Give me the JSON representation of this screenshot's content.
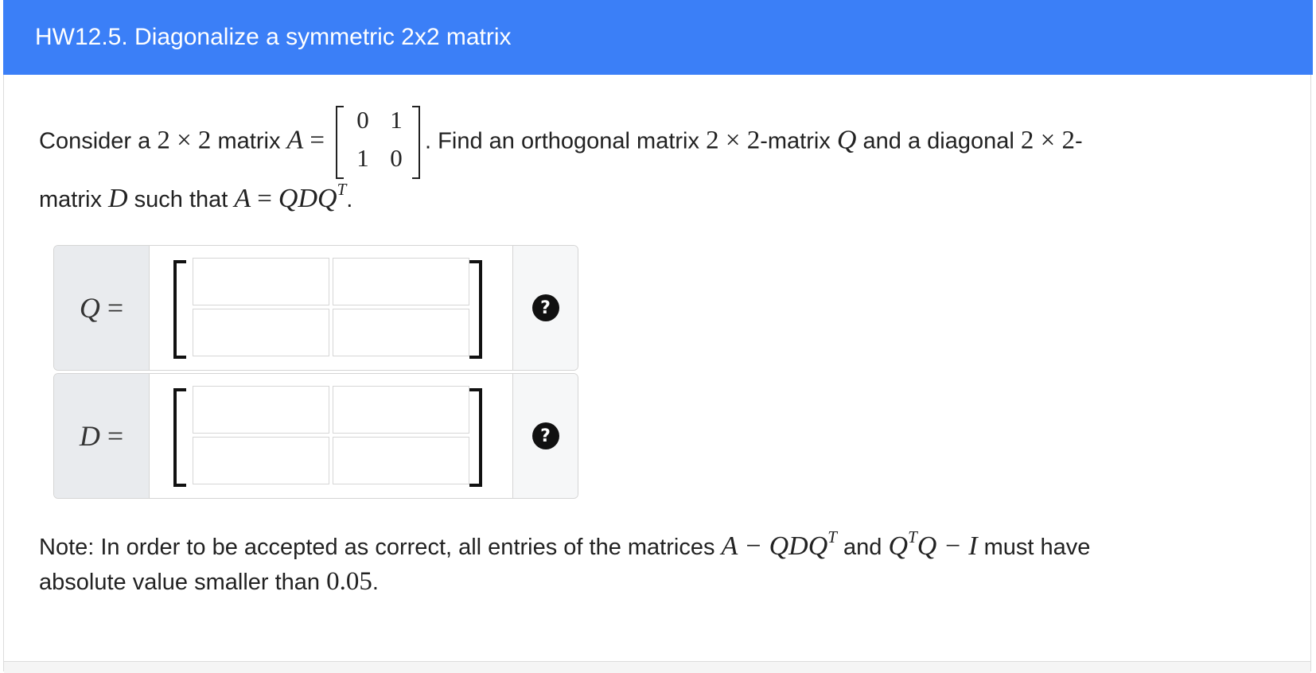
{
  "header": {
    "title": "HW12.5. Diagonalize a symmetric 2x2 matrix"
  },
  "question": {
    "consider": "Consider a",
    "dim": "2 × 2",
    "matrix_word": "matrix",
    "A": "A",
    "eq": "=",
    "A_entries": [
      [
        "0",
        "1"
      ],
      [
        "1",
        "0"
      ]
    ],
    "find": ". Find an orthogonal matrix",
    "dashmatrix": "-matrix",
    "Q": "Q",
    "and_diag": "and a diagonal",
    "dash": "-",
    "matrix2": "matrix",
    "D": "D",
    "such_that": "such that",
    "eq2_lhs": "A",
    "eq2_rhs": "QDQ",
    "T": "T",
    "period": "."
  },
  "answers": [
    {
      "label": "Q",
      "eq": "=",
      "cells": [
        "",
        "",
        "",
        ""
      ],
      "help": "?"
    },
    {
      "label": "D",
      "eq": "=",
      "cells": [
        "",
        "",
        "",
        ""
      ],
      "help": "?"
    }
  ],
  "note": {
    "prefix": "Note: In order to be accepted as correct, all entries of the matrices",
    "expr1": "A − QDQ",
    "T": "T",
    "and": "and",
    "expr2a": "Q",
    "expr2b": "Q − I",
    "suffix": "must have",
    "line2": "absolute value smaller than",
    "value": "0.05",
    "period": "."
  }
}
